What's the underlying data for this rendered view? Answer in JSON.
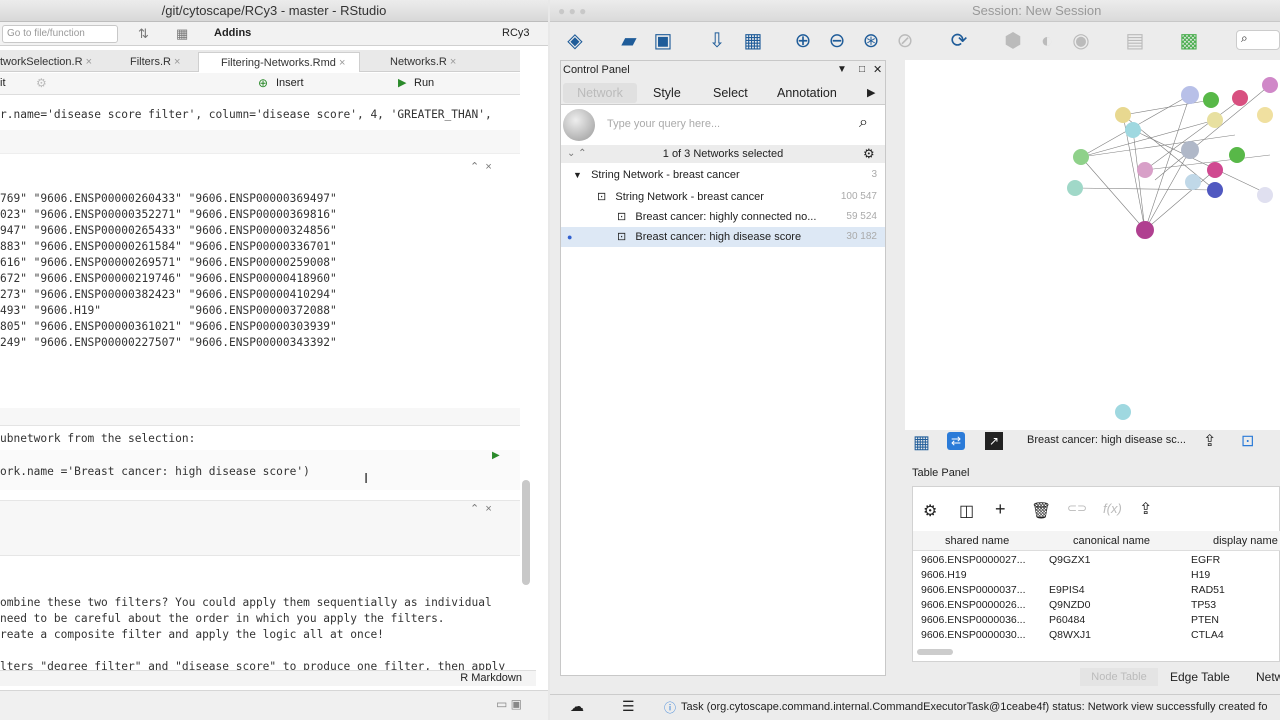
{
  "rstudio": {
    "title": "/git/cytoscape/RCy3 - master - RStudio",
    "goto_placeholder": "Go to file/function",
    "addins": "Addins",
    "project": "RCy3",
    "tabs": [
      "tworkSelection.R",
      "Filters.R",
      "Filtering-Networks.Rmd",
      "Networks.R"
    ],
    "insert": "Insert",
    "run": "Run",
    "line1": "r.name='disease score filter', column='disease score', 4, 'GREATER_THAN',",
    "rows": [
      "769\" \"9606.ENSP00000260433\" \"9606.ENSP00000369497\"",
      "023\" \"9606.ENSP00000352271\" \"9606.ENSP00000369816\"",
      "947\" \"9606.ENSP00000265433\" \"9606.ENSP00000324856\"",
      "883\" \"9606.ENSP00000261584\" \"9606.ENSP00000336701\"",
      "616\" \"9606.ENSP00000269571\" \"9606.ENSP00000259008\"",
      "672\" \"9606.ENSP00000219746\" \"9606.ENSP00000418960\"",
      "273\" \"9606.ENSP00000382423\" \"9606.ENSP00000410294\"",
      "493\" \"9606.H19\"             \"9606.ENSP00000372088\"",
      "805\" \"9606.ENSP00000361021\" \"9606.ENSP00000303939\"",
      "249\" \"9606.ENSP00000227507\" \"9606.ENSP00000343392\""
    ],
    "subnet_text": "ubnetwork from the selection:",
    "subnet_code": "ork.name ='Breast cancer: high disease score')",
    "prose": [
      "ombine these two filters? You could apply them sequentially as individual",
      "need to be careful about the order in which you apply the filters.",
      "reate a composite filter and apply the logic all at once!",
      "",
      "lters \"degree filter\" and \"disease score\" to produce one filter, then apply"
    ],
    "status_mode": "R Markdown"
  },
  "cytoscape": {
    "title": "Session: New Session",
    "control_panel": "Control Panel",
    "tabs": [
      "Network",
      "Style",
      "Select",
      "Annotation"
    ],
    "query_placeholder": "Type your query here...",
    "selected": "1 of 3 Networks selected",
    "networks": [
      {
        "label": "String Network - breast cancer",
        "count": "3"
      },
      {
        "label": "String Network - breast cancer",
        "count": "100   547"
      },
      {
        "label": "Breast cancer: highly connected no...",
        "count": "59   524"
      },
      {
        "label": "Breast cancer: high disease score",
        "count": "30   182"
      }
    ],
    "view_label": "Breast cancer: high disease sc...",
    "table_panel": "Table Panel",
    "columns": [
      "shared name",
      "canonical name",
      "display name"
    ],
    "rows": [
      [
        "9606.ENSP0000027...",
        "Q9GZX1",
        "EGFR"
      ],
      [
        "9606.H19",
        "",
        "H19"
      ],
      [
        "9606.ENSP0000037...",
        "E9PIS4",
        "RAD51"
      ],
      [
        "9606.ENSP0000026...",
        "Q9NZD0",
        "TP53"
      ],
      [
        "9606.ENSP0000036...",
        "P60484",
        "PTEN"
      ],
      [
        "9606.ENSP0000030...",
        "Q8WXJ1",
        "CTLA4"
      ]
    ],
    "table_tabs": [
      "Node Table",
      "Edge Table",
      "Netw"
    ],
    "fx": "f(x)",
    "status": "Task (org.cytoscape.command.internal.CommandExecutorTask@1ceabe4f) status: Network view successfully created fo"
  }
}
